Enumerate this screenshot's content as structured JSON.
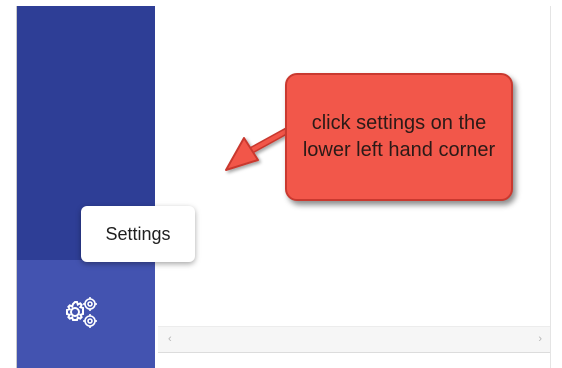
{
  "tooltip": {
    "label": "Settings"
  },
  "callout": {
    "text": "click settings on the lower left hand corner"
  },
  "sidebar": {
    "settings_icon": "gears-icon"
  },
  "scrollbar": {
    "left_arrow": "‹",
    "right_arrow": "›"
  },
  "colors": {
    "sidebar": "#2e3e96",
    "sidebar_bottom": "#4353b0",
    "callout_fill": "#f2574a",
    "callout_border": "#c9392f"
  }
}
